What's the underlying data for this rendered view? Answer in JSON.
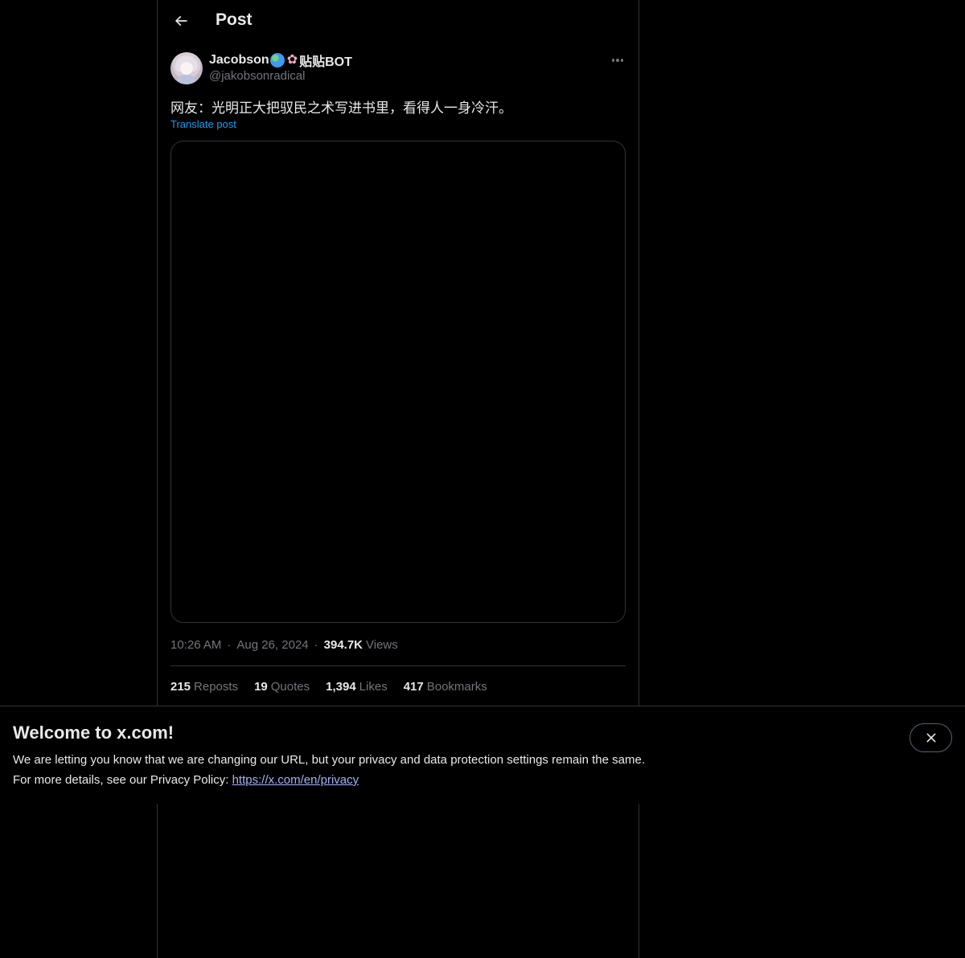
{
  "header": {
    "title": "Post"
  },
  "author": {
    "display_name": "Jacobson",
    "name_suffix": "贴贴BOT",
    "handle": "@jakobsonradical"
  },
  "post": {
    "text": "网友：光明正大把驭民之术写进书里，看得人一身冷汗。",
    "translate_label": "Translate post"
  },
  "meta": {
    "time": "10:26 AM",
    "separator": "·",
    "date": "Aug 26, 2024",
    "views_count": "394.7K",
    "views_label": "Views"
  },
  "stats": [
    {
      "count": "215",
      "label": "Reposts"
    },
    {
      "count": "19",
      "label": "Quotes"
    },
    {
      "count": "1,394",
      "label": "Likes"
    },
    {
      "count": "417",
      "label": "Bookmarks"
    }
  ],
  "banner": {
    "title": "Welcome to x.com!",
    "line1": "We are letting you know that we are changing our URL, but your privacy and data protection settings remain the same.",
    "line2_prefix": "For more details, see our Privacy Policy: ",
    "link_text": "https://x.com/en/privacy"
  },
  "colors": {
    "background": "#000000",
    "text_primary": "#e7e9ea",
    "text_secondary": "#71767b",
    "accent": "#1d9bf0",
    "border": "#2f3336"
  },
  "icons": {
    "back": "arrow-left-icon",
    "more": "more-horizontal-icon",
    "close": "close-icon"
  }
}
